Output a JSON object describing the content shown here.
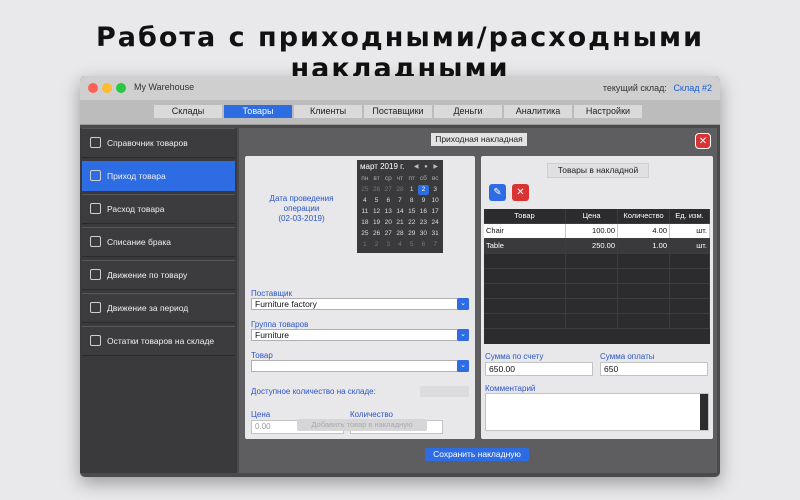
{
  "banner": {
    "title": "Работа с приходными/расходными накладными"
  },
  "window": {
    "app_title": "My Warehouse",
    "current_warehouse_label": "текущий склад:",
    "current_warehouse_value": "Склад #2"
  },
  "tabs": [
    {
      "label": "Склады",
      "active": false
    },
    {
      "label": "Товары",
      "active": true
    },
    {
      "label": "Клиенты",
      "active": false
    },
    {
      "label": "Поставщики",
      "active": false
    },
    {
      "label": "Деньги",
      "active": false
    },
    {
      "label": "Аналитика",
      "active": false
    },
    {
      "label": "Настройки",
      "active": false
    }
  ],
  "sidebar": {
    "items": [
      {
        "label": "Справочник товаров",
        "icon": "list-icon",
        "active": false
      },
      {
        "label": "Приход товара",
        "icon": "box-in-icon",
        "active": true
      },
      {
        "label": "Расход товара",
        "icon": "box-out-icon",
        "active": false
      },
      {
        "label": "Списание брака",
        "icon": "write-off-icon",
        "active": false
      },
      {
        "label": "Движение по товару",
        "icon": "cart-icon",
        "active": false
      },
      {
        "label": "Движение за период",
        "icon": "calendar-icon",
        "active": false
      },
      {
        "label": "Остатки товаров на складе",
        "icon": "scales-icon",
        "active": false
      }
    ]
  },
  "invoice": {
    "title": "Приходная накладная",
    "operation_date_label": "Дата проведения операции",
    "operation_date_value": "(02-03-2019)",
    "calendar": {
      "month_label": "март 2019 г.",
      "nav": "◀ ● ▶",
      "weekdays": [
        "пн",
        "вт",
        "ср",
        "чт",
        "пт",
        "сб",
        "вс"
      ],
      "days": [
        {
          "d": "25",
          "dim": true
        },
        {
          "d": "26",
          "dim": true
        },
        {
          "d": "27",
          "dim": true
        },
        {
          "d": "28",
          "dim": true
        },
        {
          "d": "1",
          "dim": false
        },
        {
          "d": "2",
          "dim": false,
          "sel": true
        },
        {
          "d": "3",
          "dim": false
        },
        {
          "d": "4"
        },
        {
          "d": "5"
        },
        {
          "d": "6"
        },
        {
          "d": "7"
        },
        {
          "d": "8"
        },
        {
          "d": "9"
        },
        {
          "d": "10"
        },
        {
          "d": "11"
        },
        {
          "d": "12"
        },
        {
          "d": "13"
        },
        {
          "d": "14"
        },
        {
          "d": "15"
        },
        {
          "d": "16"
        },
        {
          "d": "17"
        },
        {
          "d": "18"
        },
        {
          "d": "19"
        },
        {
          "d": "20"
        },
        {
          "d": "21"
        },
        {
          "d": "22"
        },
        {
          "d": "23"
        },
        {
          "d": "24"
        },
        {
          "d": "25"
        },
        {
          "d": "26"
        },
        {
          "d": "27"
        },
        {
          "d": "28"
        },
        {
          "d": "29"
        },
        {
          "d": "30"
        },
        {
          "d": "31"
        },
        {
          "d": "1",
          "dim": true
        },
        {
          "d": "2",
          "dim": true
        },
        {
          "d": "3",
          "dim": true
        },
        {
          "d": "4",
          "dim": true
        },
        {
          "d": "5",
          "dim": true
        },
        {
          "d": "6",
          "dim": true
        },
        {
          "d": "7",
          "dim": true
        }
      ]
    },
    "supplier_label": "Поставщик",
    "supplier_value": "Furniture factory",
    "group_label": "Группа товаров",
    "group_value": "Furniture",
    "product_label": "Товар",
    "product_value": "",
    "available_label": "Доступное количество на складе:",
    "price_label": "Цена",
    "price_placeholder": "0.00",
    "qty_label": "Количество",
    "qty_placeholder": "0.00",
    "add_button": "Добавить товар в накладную",
    "save_button": "Сохранить накладную"
  },
  "items_panel": {
    "title": "Товары в накладной",
    "columns": [
      "Товар",
      "Цена",
      "Количество",
      "Ед. изм."
    ],
    "rows": [
      {
        "name": "Chair",
        "price": "100.00",
        "qty": "4.00",
        "unit": "шт."
      },
      {
        "name": "Table",
        "price": "250.00",
        "qty": "1.00",
        "unit": "шт."
      }
    ],
    "invoice_sum_label": "Сумма по счету",
    "invoice_sum_value": "650.00",
    "paid_sum_label": "Сумма оплаты",
    "paid_sum_value": "650",
    "comment_label": "Комментарий",
    "comment_value": ""
  },
  "colors": {
    "accent": "#2e6ce3",
    "danger": "#d93434",
    "sidebar_bg": "#3a3a3c"
  }
}
